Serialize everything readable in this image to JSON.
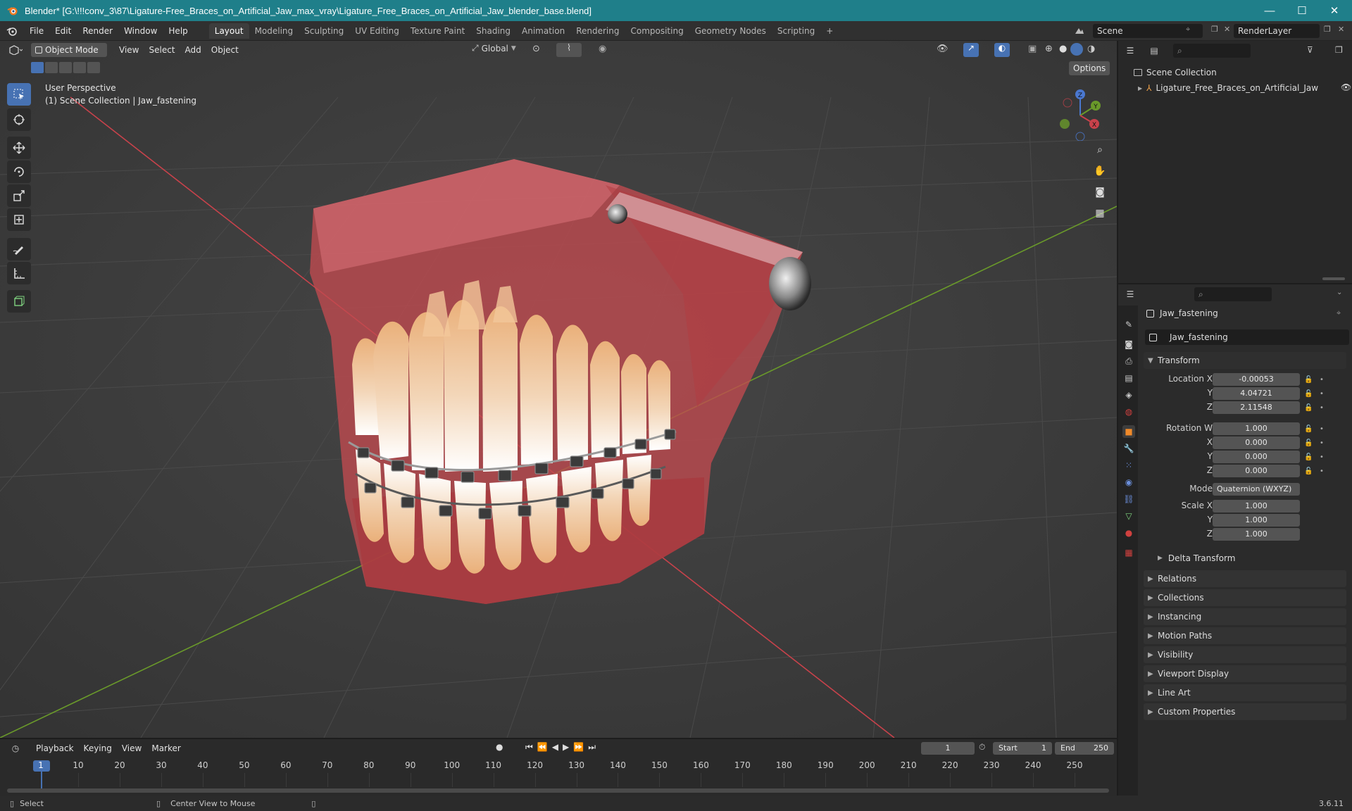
{
  "window": {
    "title": "Blender* [G:\\!!!conv_3\\87\\Ligature-Free_Braces_on_Artificial_Jaw_max_vray\\Ligature_Free_Braces_on_Artificial_Jaw_blender_base.blend]",
    "minimize": "—",
    "maximize": "☐",
    "close": "✕"
  },
  "menu": [
    "File",
    "Edit",
    "Render",
    "Window",
    "Help"
  ],
  "workspaces": [
    "Layout",
    "Modeling",
    "Sculpting",
    "UV Editing",
    "Texture Paint",
    "Shading",
    "Animation",
    "Rendering",
    "Compositing",
    "Geometry Nodes",
    "Scripting"
  ],
  "workspace_add": "+",
  "scene": {
    "name": "Scene",
    "render_layer": "RenderLayer"
  },
  "viewport": {
    "mode": "Object Mode",
    "menus": [
      "View",
      "Select",
      "Add",
      "Object"
    ],
    "orientation": "Global",
    "options_label": "Options",
    "overlay_line1": "User Perspective",
    "overlay_line2": "(1) Scene Collection | Jaw_fastening",
    "gizmo": {
      "x": "X",
      "y": "Y",
      "z": "Z"
    }
  },
  "outliner": {
    "root": "Scene Collection",
    "items": [
      {
        "label": "Ligature_Free_Braces_on_Artificial_Jaw"
      }
    ]
  },
  "properties": {
    "object_name": "Jaw_fastening",
    "data_name": "Jaw_fastening",
    "transform_header": "Transform",
    "location": {
      "label": "Location X",
      "x": "-0.00053",
      "y": "4.04721",
      "z": "2.11548"
    },
    "rotation": {
      "label": "Rotation W",
      "w": "1.000",
      "x": "0.000",
      "y": "0.000",
      "z": "0.000"
    },
    "mode": {
      "label": "Mode",
      "value": "Quaternion (WXYZ)"
    },
    "scale": {
      "label": "Scale X",
      "x": "1.000",
      "y": "1.000",
      "z": "1.000"
    },
    "axis_labels": {
      "y": "Y",
      "z": "Z",
      "x": "X"
    },
    "delta": "Delta Transform",
    "panels": [
      "Relations",
      "Collections",
      "Instancing",
      "Motion Paths",
      "Visibility",
      "Viewport Display",
      "Line Art",
      "Custom Properties"
    ]
  },
  "timeline": {
    "menus": [
      "Playback",
      "Keying",
      "View",
      "Marker"
    ],
    "current_frame": "1",
    "start_label": "Start",
    "start": "1",
    "end_label": "End",
    "end": "250",
    "ticks": [
      "1",
      "10",
      "20",
      "30",
      "40",
      "50",
      "60",
      "70",
      "80",
      "90",
      "100",
      "110",
      "120",
      "130",
      "140",
      "150",
      "160",
      "170",
      "180",
      "190",
      "200",
      "210",
      "220",
      "230",
      "240",
      "250"
    ]
  },
  "status": {
    "left": "Select",
    "middle": "Center View to Mouse",
    "version": "3.6.11"
  },
  "colors": {
    "titlebar": "#1f7f8a",
    "accent": "#4772b3",
    "x_axis": "#c8424b",
    "y_axis": "#6a9a2a",
    "jaw": "#c24a4f"
  }
}
